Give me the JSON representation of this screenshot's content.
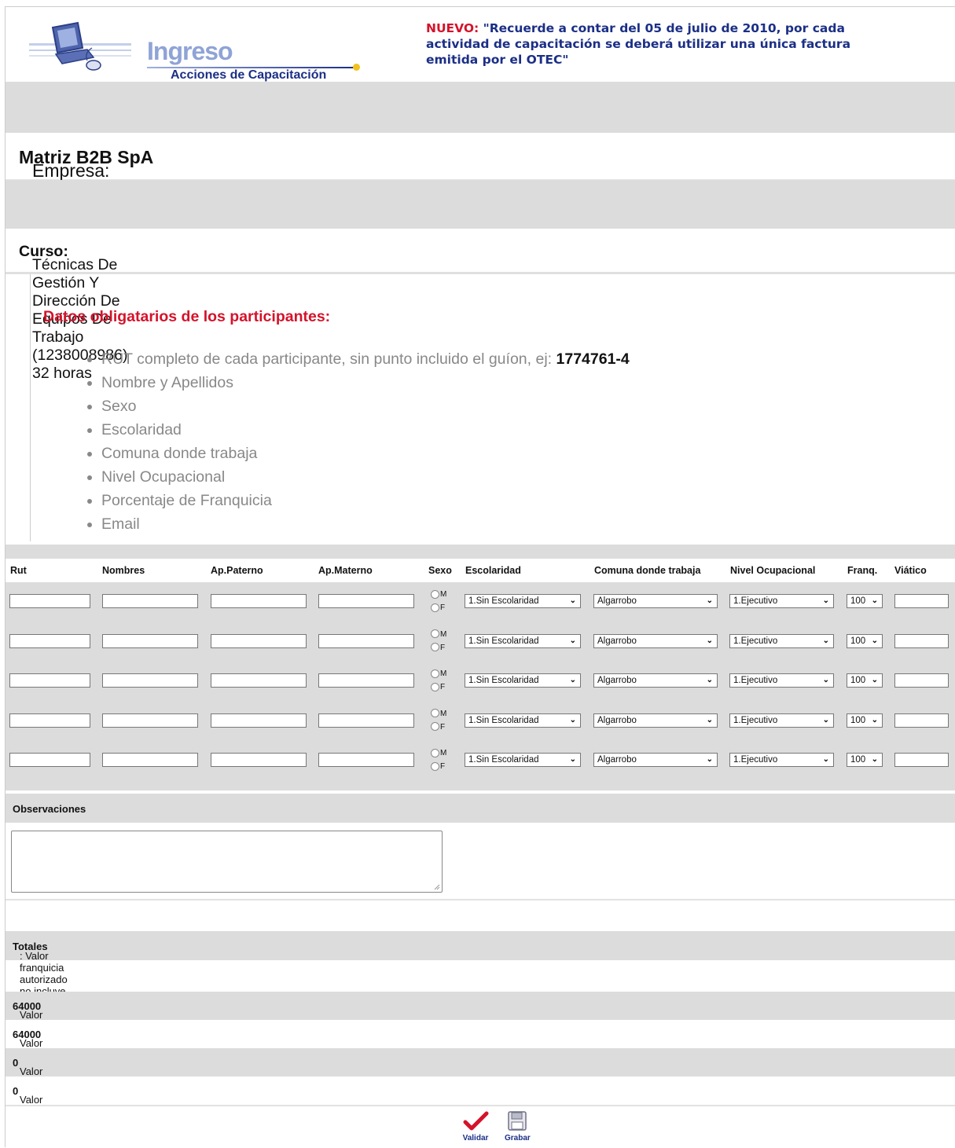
{
  "header": {
    "logo_title": "Ingreso",
    "logo_subtitle": "Acciones de Capacitación",
    "notice_prefix": "NUEVO:",
    "notice_text": " \"Recuerde a contar del 05 de julio de 2010, por cada actividad de capacitación se deberá utilizar una única factura emitida por el OTEC\""
  },
  "empresa": {
    "label": "Empresa: ",
    "value": "Matriz B2B SpA"
  },
  "curso": {
    "label": "Curso:",
    "value": " Técnicas De Gestión Y Dirección De Equipos De Trabajo (1238008986) 32 horas"
  },
  "requisitos": {
    "title": "Datos obligatarios de los participantes:",
    "rut_text": "RUT  completo de cada participante, sin punto incluido el guíon,  ej: ",
    "rut_example": "1774761-4",
    "items": [
      "Nombre y  Apellidos",
      "Sexo",
      "Escolaridad",
      "Comuna donde trabaja",
      "Nivel Ocupacional",
      "Porcentaje de Franquicia",
      "Email"
    ]
  },
  "table": {
    "headers": {
      "rut": "Rut",
      "nombres": "Nombres",
      "ap_paterno": "Ap.Paterno",
      "ap_materno": "Ap.Materno",
      "sexo": "Sexo",
      "escolaridad": "Escolaridad",
      "comuna": "Comuna donde trabaja",
      "nivel": "Nivel Ocupacional",
      "franq": "Franq.",
      "viatico": "Viático"
    },
    "sexo_m": "M",
    "sexo_f": "F",
    "escolaridad_value": "1.Sin Escolaridad",
    "comuna_value": "Algarrobo",
    "nivel_value": "1.Ejecutivo",
    "franq_value": "100",
    "row_count": 5
  },
  "observaciones": {
    "label": "Observaciones"
  },
  "totales": {
    "label": "Totales",
    "text": ": Valor franquicia autorizado no incluye viáticos ni traslados"
  },
  "valores": [
    {
      "label": "Valor Total del curso $ : ",
      "value": "64000"
    },
    {
      "label": "Valor franquicia autorizado $: ",
      "value": "64000"
    },
    {
      "label": "Valor Total Viático $: ",
      "value": "0"
    },
    {
      "label": "Valor Total Traslado $: ",
      "value": "0"
    }
  ],
  "actions": {
    "validar": "Validar",
    "grabar": "Grabar"
  },
  "colors": {
    "accent_red": "#d4132b",
    "brand_blue": "#1b2f86",
    "band_gray": "#dcdcdc"
  }
}
